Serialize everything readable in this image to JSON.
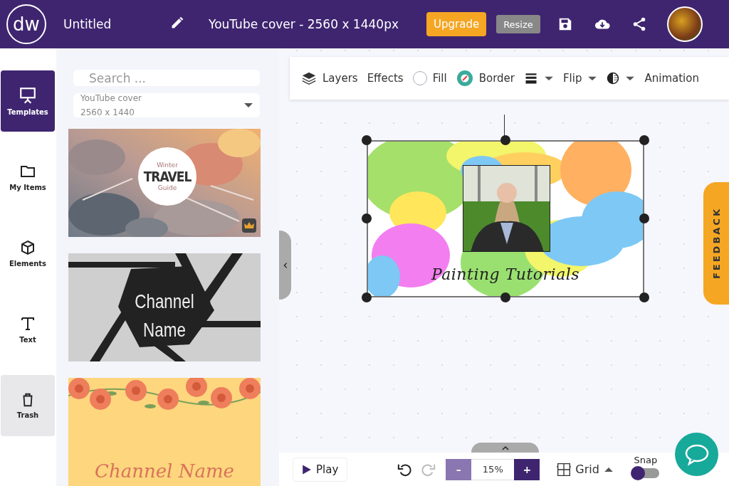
{
  "header": {
    "logo": "dw",
    "title": "Untitled",
    "document": "YouTube cover - 2560 x 1440px",
    "upgrade": "Upgrade",
    "resize": "Resize"
  },
  "rail": [
    {
      "kind": "templates",
      "label": "Templates",
      "selected": true,
      "highlighted": false
    },
    {
      "kind": "folder",
      "label": "My Items",
      "selected": false,
      "highlighted": false
    },
    {
      "kind": "cube",
      "label": "Elements",
      "selected": false,
      "highlighted": false
    },
    {
      "kind": "text",
      "label": "Text",
      "selected": false,
      "highlighted": false
    },
    {
      "kind": "trash",
      "label": "Trash",
      "selected": false,
      "highlighted": true
    }
  ],
  "panel": {
    "search": {
      "placeholder": "Search ..."
    },
    "size_select": {
      "value": "YouTube cover",
      "detail": "2560 x 1440"
    },
    "templates": [
      {
        "kind": "travel",
        "lines": [
          "Winter",
          "TRAVEL",
          "Guide"
        ],
        "premium": true
      },
      {
        "kind": "shutter",
        "lines": [
          "Channel",
          "Name"
        ],
        "premium": false
      },
      {
        "kind": "floral",
        "lines": [
          "Channel Name"
        ],
        "premium": false
      }
    ]
  },
  "toolbar": [
    {
      "kind": "layers",
      "label": "Layers"
    },
    {
      "kind": "plain",
      "label": "Effects"
    },
    {
      "kind": "fill",
      "label": "Fill"
    },
    {
      "kind": "border",
      "label": "Border"
    },
    {
      "kind": "lines"
    },
    {
      "kind": "flip",
      "label": "Flip"
    },
    {
      "kind": "contrast"
    },
    {
      "kind": "plain",
      "label": "Animation"
    }
  ],
  "design": {
    "title": "Painting Tutorials"
  },
  "feedback": "FEEDBACK",
  "bottom": {
    "play": "Play",
    "zoom_out": "–",
    "zoom": "15%",
    "zoom_in": "+",
    "grid": "Grid",
    "snap": {
      "label": "Snap",
      "on": false
    }
  }
}
